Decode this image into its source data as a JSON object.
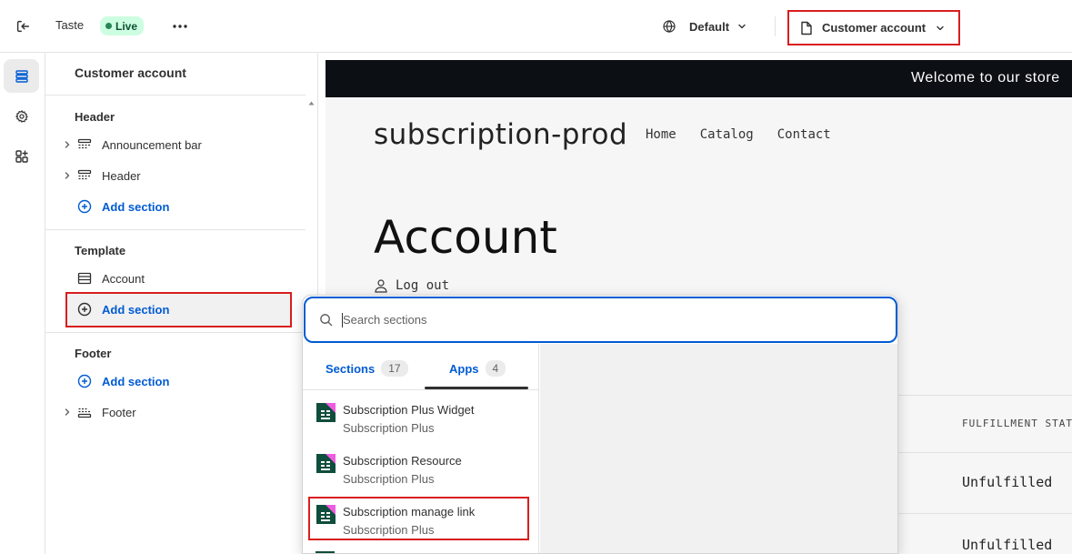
{
  "topbar": {
    "theme_name": "Taste",
    "status_badge": "Live",
    "viewport_label": "Default",
    "page_select_label": "Customer account"
  },
  "sidebar": {
    "title": "Customer account",
    "header_group": {
      "label": "Header",
      "items": [
        "Announcement bar",
        "Header"
      ],
      "add_label": "Add section"
    },
    "template_group": {
      "label": "Template",
      "items": [
        "Account"
      ],
      "add_label": "Add section"
    },
    "footer_group": {
      "label": "Footer",
      "add_label": "Add section",
      "items": [
        "Footer"
      ]
    }
  },
  "preview": {
    "announcement": "Welcome to our store",
    "store_name": "subscription-prod",
    "nav": [
      "Home",
      "Catalog",
      "Contact"
    ],
    "account_title": "Account",
    "logout_label": "Log out",
    "table_header": "FULFILLMENT STATUS",
    "rows": [
      "Unfulfilled",
      "Unfulfilled"
    ]
  },
  "picker": {
    "search_placeholder": "Search sections",
    "tabs": [
      {
        "label": "Sections",
        "count": "17"
      },
      {
        "label": "Apps",
        "count": "4"
      }
    ],
    "apps": [
      {
        "name": "Subscription Plus Widget",
        "vendor": "Subscription Plus"
      },
      {
        "name": "Subscription Resource",
        "vendor": "Subscription Plus"
      },
      {
        "name": "Subscription manage link",
        "vendor": "Subscription Plus"
      }
    ]
  },
  "colors": {
    "accent": "#005bd3",
    "highlight": "#d91e1e",
    "live_badge": "#cdfee1",
    "app_logo_dark": "#0f4d3c",
    "app_logo_pink": "#ee5ce0"
  }
}
